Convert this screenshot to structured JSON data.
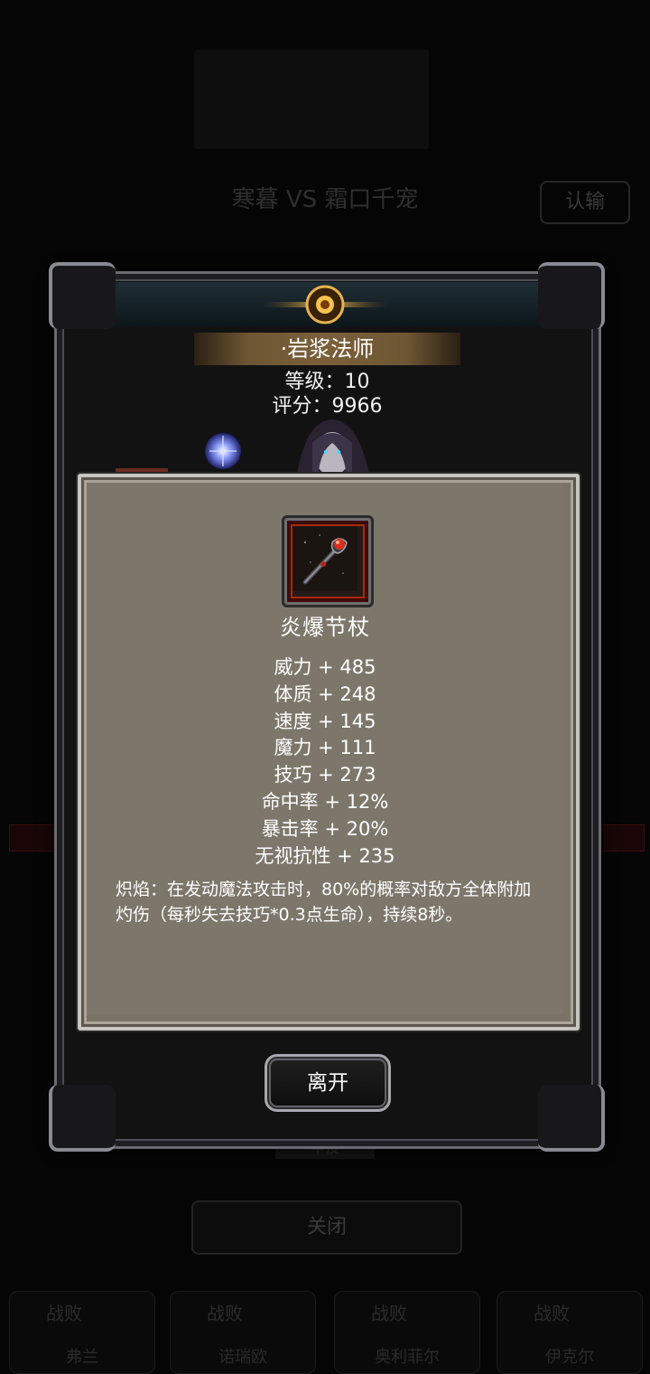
{
  "background": {
    "match_title": "寒暮 VS 霜口千宠",
    "concede_label": "认输",
    "ticket_label": "半投",
    "close_label": "关闭",
    "results": [
      {
        "result": "战败",
        "name": "弗兰"
      },
      {
        "result": "战败",
        "name": "诺瑞欧"
      },
      {
        "result": "战败",
        "name": "奥利菲尔"
      },
      {
        "result": "战败",
        "name": "伊克尔"
      }
    ]
  },
  "hero": {
    "name": "·岩浆法师",
    "level": "等级：10",
    "score": "评分：9966"
  },
  "item": {
    "name": "炎爆节杖",
    "stats": [
      "威力 + 485",
      "体质 + 248",
      "速度 + 145",
      "魔力 + 111",
      "技巧 + 273",
      "命中率 + 12%",
      "暴击率 + 20%",
      "无视抗性 + 235"
    ],
    "effect": "炽焰：在发动魔法攻击时，80%的概率对敌方全体附加灼伤（每秒失去技巧*0.3点生命），持续8秒。",
    "icon": "fire-staff-icon"
  },
  "leave_button": {
    "label": "离开"
  },
  "colors": {
    "panel_bg": "#7d776b",
    "frame_border": "#6a6a70",
    "item_frame_red": "#a8280e"
  }
}
